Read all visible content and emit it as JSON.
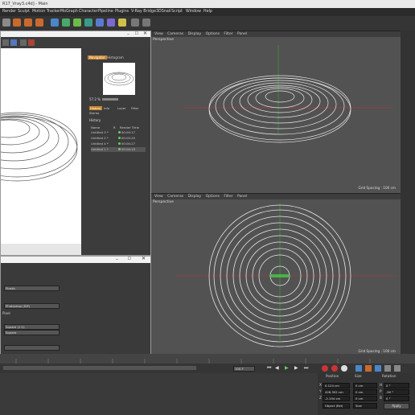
{
  "window": {
    "title": "R17_Vray3.c4d] - Main"
  },
  "menu": [
    "Render",
    "Sculpt",
    "Motion Tracker",
    "MoGraph",
    "Character",
    "Pipeline",
    "Plugins",
    "V-Ray Bridge",
    "3DSnail",
    "Script",
    "Window",
    "Help"
  ],
  "viewport_top": {
    "menu": [
      "View",
      "Cameras",
      "Display",
      "Options",
      "Filter",
      "Panel"
    ],
    "label": "Perspective",
    "grid": "Grid Spacing : 100 cm"
  },
  "viewport_bottom": {
    "menu": [
      "View",
      "Cameras",
      "Display",
      "Options",
      "Filter",
      "Panel"
    ],
    "label": "Perspective",
    "grid": "Grid Spacing : 100 cm"
  },
  "render_window": {
    "tabs": [
      "Navigator",
      "Histogram"
    ],
    "zoom": "57.2 %",
    "info_tabs": [
      "History",
      "Info",
      "Layer",
      "Filter",
      "Stereo"
    ],
    "history_title": "History",
    "columns": [
      "Name",
      "R",
      "Render Time"
    ],
    "rows": [
      {
        "name": "Untitled 3 *",
        "time": "00:00:17"
      },
      {
        "name": "Untitled 2 *",
        "time": "00:00:20"
      },
      {
        "name": "Untitled 4 *",
        "time": "00:00:27"
      },
      {
        "name": "Untitled 1 *",
        "time": "00:00:19"
      }
    ]
  },
  "settings_window": {
    "values": [
      "Plastic",
      "Photoshop (DIF)",
      "Square (1:1)",
      "Square"
    ],
    "pixel_label": "Pixel"
  },
  "timeline": {
    "frame_field": "100 F"
  },
  "coordinates": {
    "headers": [
      "Position",
      "Size",
      "Rotation"
    ],
    "rows": [
      {
        "axis": "X",
        "pos": "0.124 cm",
        "size": "0 cm",
        "rot_axis": "H",
        "rot": "0 °"
      },
      {
        "axis": "Y",
        "pos": "428.302 cm",
        "size": "0 cm",
        "rot_axis": "P",
        "rot": "-90 °"
      },
      {
        "axis": "Z",
        "pos": "-2.194 cm",
        "size": "0 cm",
        "rot_axis": "B",
        "rot": "0 °"
      }
    ],
    "mode_left": "Object (Rel)",
    "mode_mid": "Size",
    "apply": "Apply"
  }
}
